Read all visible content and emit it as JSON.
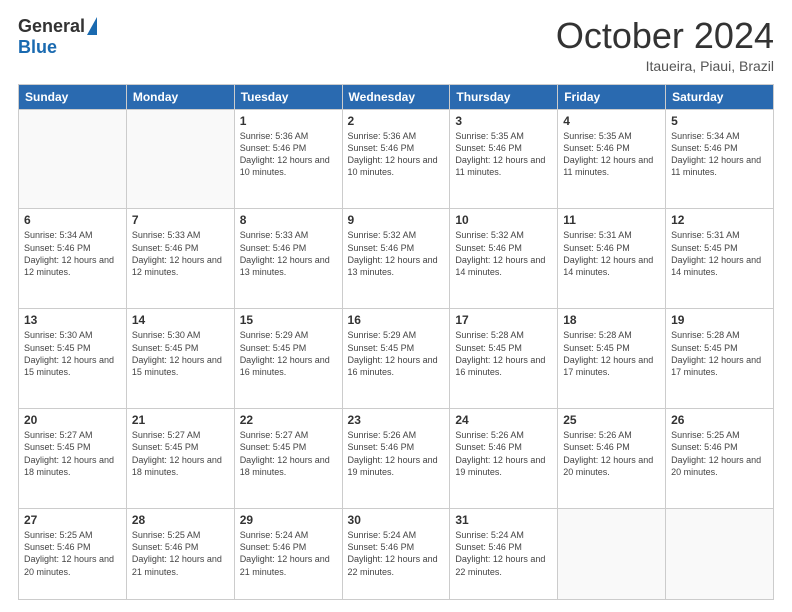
{
  "logo": {
    "general": "General",
    "blue": "Blue"
  },
  "header": {
    "month": "October 2024",
    "location": "Itaueira, Piaui, Brazil"
  },
  "days_of_week": [
    "Sunday",
    "Monday",
    "Tuesday",
    "Wednesday",
    "Thursday",
    "Friday",
    "Saturday"
  ],
  "weeks": [
    [
      {
        "day": "",
        "info": ""
      },
      {
        "day": "",
        "info": ""
      },
      {
        "day": "1",
        "info": "Sunrise: 5:36 AM\nSunset: 5:46 PM\nDaylight: 12 hours and 10 minutes."
      },
      {
        "day": "2",
        "info": "Sunrise: 5:36 AM\nSunset: 5:46 PM\nDaylight: 12 hours and 10 minutes."
      },
      {
        "day": "3",
        "info": "Sunrise: 5:35 AM\nSunset: 5:46 PM\nDaylight: 12 hours and 11 minutes."
      },
      {
        "day": "4",
        "info": "Sunrise: 5:35 AM\nSunset: 5:46 PM\nDaylight: 12 hours and 11 minutes."
      },
      {
        "day": "5",
        "info": "Sunrise: 5:34 AM\nSunset: 5:46 PM\nDaylight: 12 hours and 11 minutes."
      }
    ],
    [
      {
        "day": "6",
        "info": "Sunrise: 5:34 AM\nSunset: 5:46 PM\nDaylight: 12 hours and 12 minutes."
      },
      {
        "day": "7",
        "info": "Sunrise: 5:33 AM\nSunset: 5:46 PM\nDaylight: 12 hours and 12 minutes."
      },
      {
        "day": "8",
        "info": "Sunrise: 5:33 AM\nSunset: 5:46 PM\nDaylight: 12 hours and 13 minutes."
      },
      {
        "day": "9",
        "info": "Sunrise: 5:32 AM\nSunset: 5:46 PM\nDaylight: 12 hours and 13 minutes."
      },
      {
        "day": "10",
        "info": "Sunrise: 5:32 AM\nSunset: 5:46 PM\nDaylight: 12 hours and 14 minutes."
      },
      {
        "day": "11",
        "info": "Sunrise: 5:31 AM\nSunset: 5:46 PM\nDaylight: 12 hours and 14 minutes."
      },
      {
        "day": "12",
        "info": "Sunrise: 5:31 AM\nSunset: 5:45 PM\nDaylight: 12 hours and 14 minutes."
      }
    ],
    [
      {
        "day": "13",
        "info": "Sunrise: 5:30 AM\nSunset: 5:45 PM\nDaylight: 12 hours and 15 minutes."
      },
      {
        "day": "14",
        "info": "Sunrise: 5:30 AM\nSunset: 5:45 PM\nDaylight: 12 hours and 15 minutes."
      },
      {
        "day": "15",
        "info": "Sunrise: 5:29 AM\nSunset: 5:45 PM\nDaylight: 12 hours and 16 minutes."
      },
      {
        "day": "16",
        "info": "Sunrise: 5:29 AM\nSunset: 5:45 PM\nDaylight: 12 hours and 16 minutes."
      },
      {
        "day": "17",
        "info": "Sunrise: 5:28 AM\nSunset: 5:45 PM\nDaylight: 12 hours and 16 minutes."
      },
      {
        "day": "18",
        "info": "Sunrise: 5:28 AM\nSunset: 5:45 PM\nDaylight: 12 hours and 17 minutes."
      },
      {
        "day": "19",
        "info": "Sunrise: 5:28 AM\nSunset: 5:45 PM\nDaylight: 12 hours and 17 minutes."
      }
    ],
    [
      {
        "day": "20",
        "info": "Sunrise: 5:27 AM\nSunset: 5:45 PM\nDaylight: 12 hours and 18 minutes."
      },
      {
        "day": "21",
        "info": "Sunrise: 5:27 AM\nSunset: 5:45 PM\nDaylight: 12 hours and 18 minutes."
      },
      {
        "day": "22",
        "info": "Sunrise: 5:27 AM\nSunset: 5:45 PM\nDaylight: 12 hours and 18 minutes."
      },
      {
        "day": "23",
        "info": "Sunrise: 5:26 AM\nSunset: 5:46 PM\nDaylight: 12 hours and 19 minutes."
      },
      {
        "day": "24",
        "info": "Sunrise: 5:26 AM\nSunset: 5:46 PM\nDaylight: 12 hours and 19 minutes."
      },
      {
        "day": "25",
        "info": "Sunrise: 5:26 AM\nSunset: 5:46 PM\nDaylight: 12 hours and 20 minutes."
      },
      {
        "day": "26",
        "info": "Sunrise: 5:25 AM\nSunset: 5:46 PM\nDaylight: 12 hours and 20 minutes."
      }
    ],
    [
      {
        "day": "27",
        "info": "Sunrise: 5:25 AM\nSunset: 5:46 PM\nDaylight: 12 hours and 20 minutes."
      },
      {
        "day": "28",
        "info": "Sunrise: 5:25 AM\nSunset: 5:46 PM\nDaylight: 12 hours and 21 minutes."
      },
      {
        "day": "29",
        "info": "Sunrise: 5:24 AM\nSunset: 5:46 PM\nDaylight: 12 hours and 21 minutes."
      },
      {
        "day": "30",
        "info": "Sunrise: 5:24 AM\nSunset: 5:46 PM\nDaylight: 12 hours and 22 minutes."
      },
      {
        "day": "31",
        "info": "Sunrise: 5:24 AM\nSunset: 5:46 PM\nDaylight: 12 hours and 22 minutes."
      },
      {
        "day": "",
        "info": ""
      },
      {
        "day": "",
        "info": ""
      }
    ]
  ]
}
